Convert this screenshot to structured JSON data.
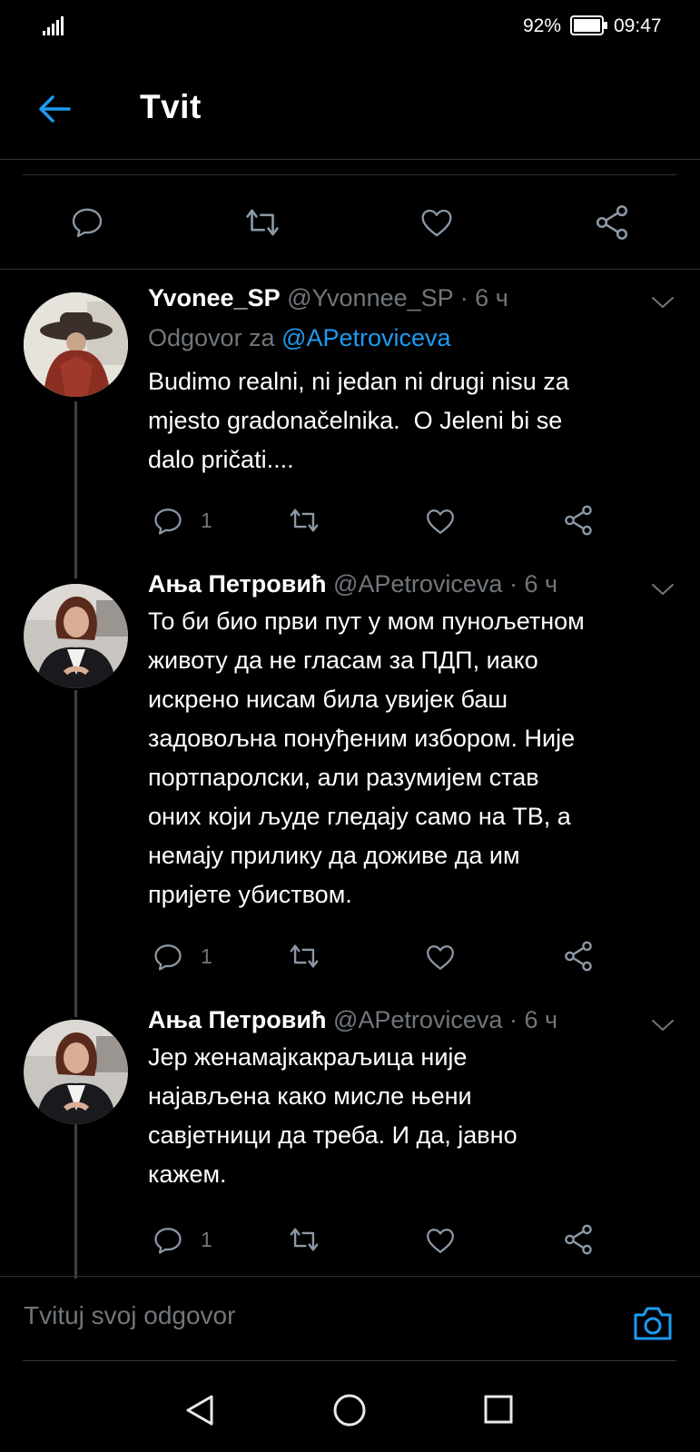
{
  "status_bar": {
    "battery": "92%",
    "time": "09:47"
  },
  "header": {
    "title": "Tvit"
  },
  "composer": {
    "placeholder": "Tvituj svoj odgovor"
  },
  "colors": {
    "accent": "#1d9bf0",
    "background": "#000000",
    "muted": "#71767b"
  },
  "tweets": [
    {
      "name": "Yvonee_SP",
      "handle": "@Yvonnee_SP",
      "time": "· 6 ч",
      "reply_prefix": "Odgovor za",
      "reply_to": "@APetroviceva",
      "text": "Budimo realni, ni jedan ni drugi nisu za\nmjesto gradonačelnika.  O Jeleni bi se\ndalo pričati....",
      "reply_count": "1"
    },
    {
      "name": "Ања Петровић",
      "handle": "@APetroviceva",
      "time": "· 6 ч",
      "text": "То би био први пут у мом пунољетном\nживоту да не гласам за ПДП, иако\nискрено нисам била увијек баш\nзадовољна понуђеним избором. Није\nпортпаролски, али разумијем став\nоних који људе гледају само на ТВ, а\nнемају прилику да доживе да им\nпријете убиством.",
      "reply_count": "1"
    },
    {
      "name": "Ања Петровић",
      "handle": "@APetroviceva",
      "time": "· 6 ч",
      "text": "Јер женамајкакраљица није\nнајављена како мисле њени\nсавјетници да треба. И да, јавно\nкажем.",
      "reply_count": "1"
    }
  ]
}
